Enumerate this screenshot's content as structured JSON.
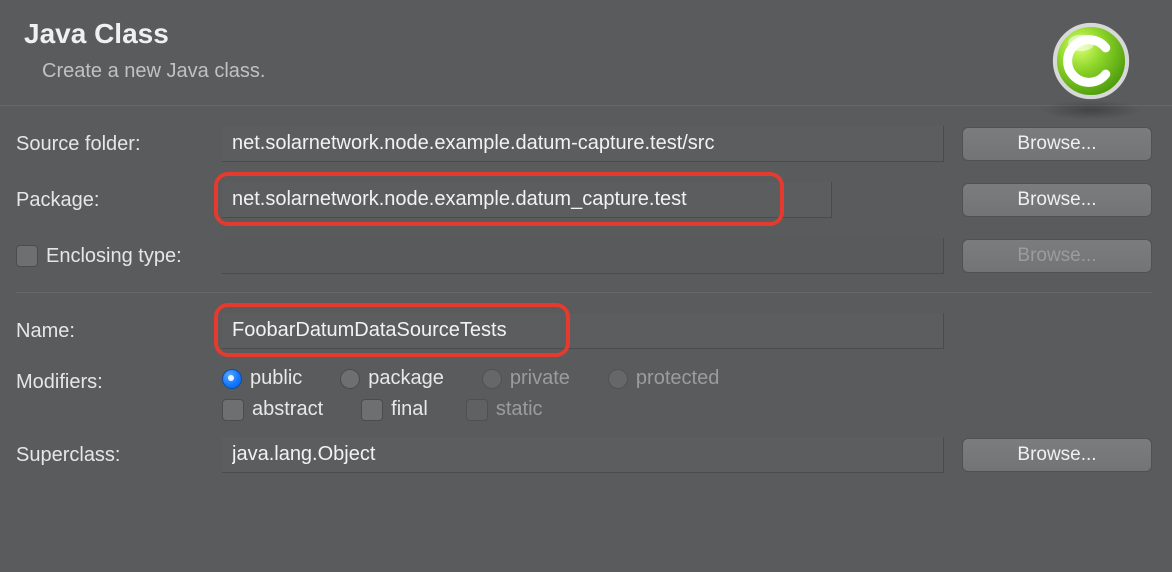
{
  "header": {
    "title": "Java Class",
    "subtitle": "Create a new Java class."
  },
  "labels": {
    "source_folder": "Source folder:",
    "package": "Package:",
    "enclosing_type": "Enclosing type:",
    "name": "Name:",
    "modifiers": "Modifiers:",
    "superclass": "Superclass:"
  },
  "fields": {
    "source_folder": "net.solarnetwork.node.example.datum-capture.test/src",
    "package": "net.solarnetwork.node.example.datum_capture.test",
    "enclosing_type": "",
    "name": "FoobarDatumDataSourceTests",
    "superclass": "java.lang.Object"
  },
  "buttons": {
    "browse": "Browse..."
  },
  "modifiers": {
    "access": {
      "public": "public",
      "package": "package",
      "private": "private",
      "protected": "protected"
    },
    "flags": {
      "abstract": "abstract",
      "final": "final",
      "static": "static"
    }
  }
}
